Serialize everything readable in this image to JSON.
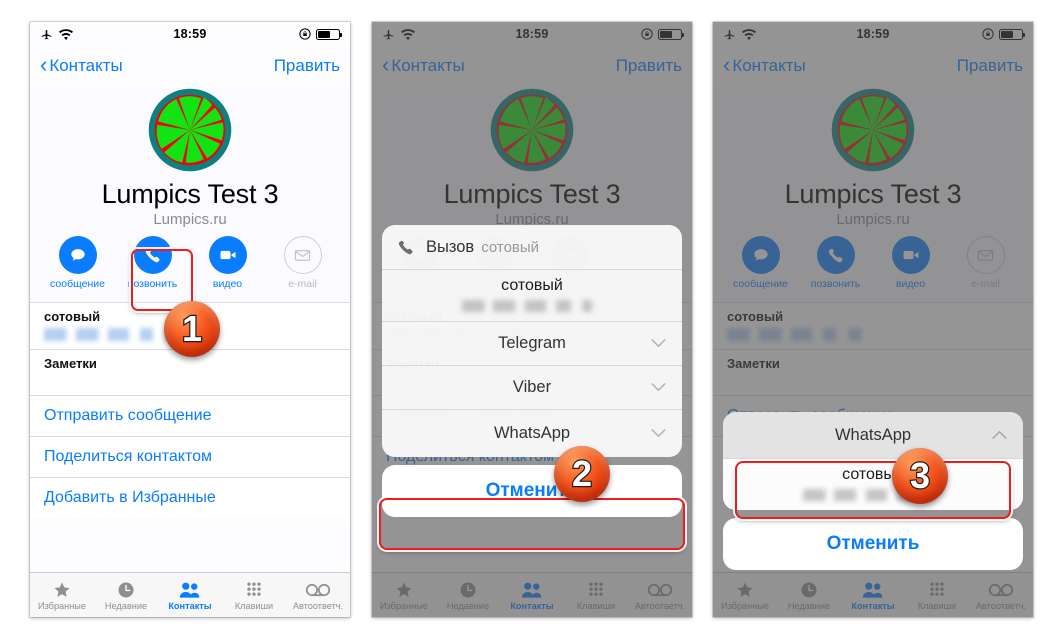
{
  "status_bar": {
    "time": "18:59",
    "airplane_icon": "airplane-icon",
    "wifi_icon": "wifi-icon",
    "lock_icon": "rotation-lock-icon",
    "battery_icon": "battery-icon"
  },
  "nav": {
    "back_label": "Контакты",
    "edit_label": "Править"
  },
  "contact": {
    "name": "Lumpics Test 3",
    "organization": "Lumpics.ru",
    "avatar_name": "citrus-slice-avatar",
    "avatar_colors": {
      "ring": "#0d8080",
      "rind": "#f2000b",
      "flesh": "#12e312"
    }
  },
  "actions": [
    {
      "label": "сообщение",
      "icon": "message-icon",
      "enabled": true
    },
    {
      "label": "позвонить",
      "icon": "phone-icon",
      "enabled": true
    },
    {
      "label": "видео",
      "icon": "video-camera-icon",
      "enabled": true
    },
    {
      "label": "e-mail",
      "icon": "envelope-icon",
      "enabled": false
    }
  ],
  "info_rows": [
    {
      "key": "сотовый",
      "value_blurred": true
    },
    {
      "key": "Заметки",
      "value_blurred": false
    }
  ],
  "link_rows": [
    {
      "label": "Отправить сообщение"
    },
    {
      "label": "Поделиться контактом"
    },
    {
      "label": "Добавить в Избранные"
    }
  ],
  "tabbar": {
    "items": [
      {
        "label": "Избранные",
        "icon": "star-icon",
        "active": false
      },
      {
        "label": "Недавние",
        "icon": "clock-icon",
        "active": false
      },
      {
        "label": "Контакты",
        "icon": "contacts-icon",
        "active": true
      },
      {
        "label": "Клавиши",
        "icon": "keypad-icon",
        "active": false
      },
      {
        "label": "Автоответч.",
        "icon": "voicemail-icon",
        "active": false
      }
    ]
  },
  "sheet_panel2": {
    "call_row": {
      "icon": "phone-handset-icon",
      "title": "Вызов",
      "subtitle": "сотовый"
    },
    "rows": [
      {
        "name": "сотовый",
        "blurred_number": true,
        "type": "stacked"
      },
      {
        "name": "Telegram",
        "type": "expandable",
        "chevron": "chevron-down-icon"
      },
      {
        "name": "Viber",
        "type": "expandable",
        "chevron": "chevron-down-icon"
      },
      {
        "name": "WhatsApp",
        "type": "expandable",
        "chevron": "chevron-down-icon",
        "highlighted": true
      }
    ],
    "cancel_label": "Отменить"
  },
  "sheet_panel3": {
    "header": {
      "name": "WhatsApp",
      "chevron": "chevron-up-icon"
    },
    "rows": [
      {
        "name": "сотовый",
        "blurred_number": true,
        "type": "stacked",
        "highlighted": true
      }
    ],
    "cancel_label": "Отменить"
  },
  "step_badges": [
    {
      "number": "1",
      "panel": 1
    },
    {
      "number": "2",
      "panel": 2
    },
    {
      "number": "3",
      "panel": 3
    }
  ],
  "colors": {
    "ios_blue": "#0a7cff",
    "highlight_red": "#ee1c1c",
    "badge_orange": "#f4571d",
    "dim_overlay": "rgba(84,84,84,.62)"
  }
}
